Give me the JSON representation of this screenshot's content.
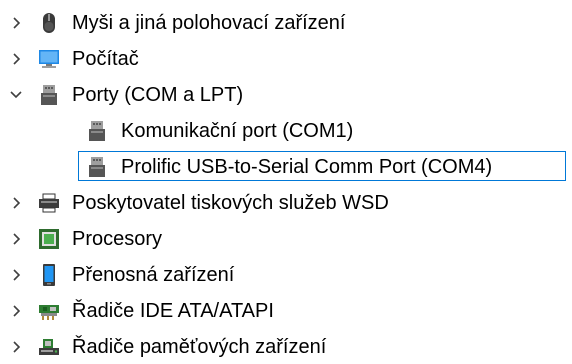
{
  "tree": {
    "items": [
      {
        "label": "Myši a jiná polohovací zařízení",
        "icon": "mouse-icon",
        "state": "collapsed"
      },
      {
        "label": "Počítač",
        "icon": "computer-icon",
        "state": "collapsed"
      },
      {
        "label": "Porty (COM a LPT)",
        "icon": "port-icon",
        "state": "expanded",
        "children": [
          {
            "label": "Komunikační port (COM1)",
            "icon": "port-icon"
          },
          {
            "label": "Prolific USB-to-Serial Comm Port (COM4)",
            "icon": "port-icon",
            "selected": true
          }
        ]
      },
      {
        "label": "Poskytovatel tiskových služeb WSD",
        "icon": "printer-icon",
        "state": "collapsed"
      },
      {
        "label": "Procesory",
        "icon": "processor-icon",
        "state": "collapsed"
      },
      {
        "label": "Přenosná zařízení",
        "icon": "portable-device-icon",
        "state": "collapsed"
      },
      {
        "label": "Řadiče IDE ATA/ATAPI",
        "icon": "ide-controller-icon",
        "state": "collapsed"
      },
      {
        "label": "Řadiče paměťových zařízení",
        "icon": "storage-controller-icon",
        "state": "collapsed"
      }
    ]
  },
  "colors": {
    "selection_border": "#0078d7",
    "twisty": "#404040"
  }
}
